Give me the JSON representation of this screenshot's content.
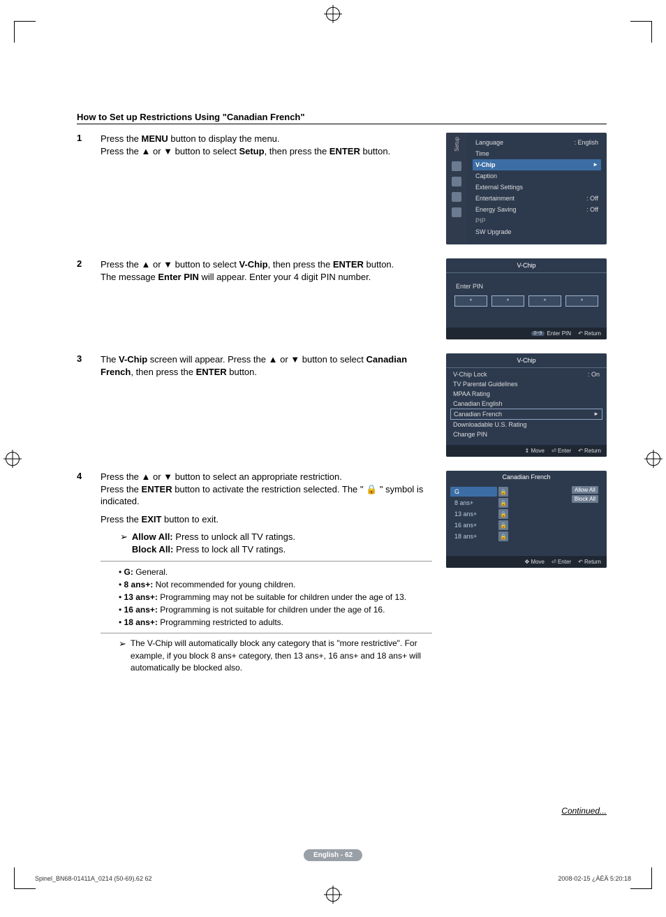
{
  "title": "How to Set up Restrictions Using \"Canadian French\"",
  "steps": {
    "s1": {
      "num": "1",
      "line1a": "Press the ",
      "line1b": "MENU",
      "line1c": " button to display the menu.",
      "line2a": "Press the ▲ or ▼ button to select ",
      "line2b": "Setup",
      "line2c": ", then press the ",
      "line2d": "ENTER",
      "line2e": " button."
    },
    "s2": {
      "num": "2",
      "line1a": "Press the ▲ or ▼ button to select ",
      "line1b": "V-Chip",
      "line1c": ", then press the ",
      "line1d": "ENTER",
      "line1e": " button.",
      "line2a": "The message ",
      "line2b": "Enter PIN",
      "line2c": " will appear. Enter your 4 digit PIN number."
    },
    "s3": {
      "num": "3",
      "line1a": "The ",
      "line1b": "V-Chip",
      "line1c": " screen will appear. Press the ▲ or ▼ button to select ",
      "line1d": "Canadian French",
      "line1e": ", then press the ",
      "line1f": "ENTER",
      "line1g": " button."
    },
    "s4": {
      "num": "4",
      "line1": "Press the ▲ or ▼ button to select an appropriate restriction.",
      "line2a": "Press the ",
      "line2b": "ENTER",
      "line2c": " button to activate the restriction selected. The \" 🔒 \" symbol is indicated.",
      "line3a": "Press the ",
      "line3b": "EXIT",
      "line3c": " button to exit.",
      "bullet1a": "Allow All:",
      "bullet1b": " Press to unlock all TV ratings.",
      "bullet2a": "Block All:",
      "bullet2b": " Press to lock all TV ratings."
    }
  },
  "definitions": {
    "g": {
      "k": "G:",
      "v": " General."
    },
    "a8": {
      "k": "8 ans+:",
      "v": " Not recommended for young children."
    },
    "a13": {
      "k": "13 ans+:",
      "v": " Programming may not be suitable for children under the age of 13."
    },
    "a16": {
      "k": "16 ans+:",
      "v": " Programming is not suitable for children under the age of 16."
    },
    "a18": {
      "k": "18 ans+:",
      "v": " Programming restricted to adults."
    }
  },
  "note": {
    "arrow": "➢",
    "text": "The V-Chip will automatically block any category that is \"more restrictive\". For example, if you block 8 ans+ category, then 13 ans+, 16 ans+ and 18 ans+ will automatically be blocked also."
  },
  "osd1": {
    "sideLabel": "Setup",
    "rows": {
      "language": {
        "label": "Language",
        "value": ": English"
      },
      "time": {
        "label": "Time",
        "value": ""
      },
      "vchip": {
        "label": "V-Chip",
        "value": "►"
      },
      "caption": {
        "label": "Caption",
        "value": ""
      },
      "ext": {
        "label": "External Settings",
        "value": ""
      },
      "ent": {
        "label": "Entertainment",
        "value": ": Off"
      },
      "energy": {
        "label": "Energy Saving",
        "value": ": Off"
      },
      "pip": {
        "label": "PIP",
        "value": ""
      },
      "sw": {
        "label": "SW Upgrade",
        "value": ""
      }
    }
  },
  "osd2": {
    "title": "V-Chip",
    "pinLabel": "Enter PIN",
    "star": "*",
    "footer": {
      "pill": "0~9",
      "enter": "Enter PIN",
      "ret": "↶ Return"
    }
  },
  "osd3": {
    "title": "V-Chip",
    "rows": {
      "lock": {
        "label": "V-Chip Lock",
        "value": ": On"
      },
      "tvpg": {
        "label": "TV Parental Guidelines"
      },
      "mpaa": {
        "label": "MPAA Rating"
      },
      "ce": {
        "label": "Canadian English"
      },
      "cf": {
        "label": "Canadian French",
        "value": "►"
      },
      "dus": {
        "label": "Downloadable U.S. Rating"
      },
      "cp": {
        "label": "Change PIN"
      }
    },
    "footer": {
      "move": "⇕ Move",
      "enter": "⏎ Enter",
      "ret": "↶ Return"
    }
  },
  "osd4": {
    "title": "Canadian French",
    "ratings": {
      "g": "G",
      "a8": "8 ans+",
      "a13": "13 ans+",
      "a16": "16 ans+",
      "a18": "18 ans+"
    },
    "allow": "Allow All",
    "block": "Block All",
    "lock": "🔒",
    "footer": {
      "move": "✥ Move",
      "enter": "⏎ Enter",
      "ret": "↶ Return"
    }
  },
  "continued": "Continued...",
  "pagePill": "English - 62",
  "footer": {
    "left": "Spinel_BN68-01411A_0214 (50-69).62   62",
    "right": "2008-02-15   ¿ÀÈÄ 5:20:18"
  }
}
